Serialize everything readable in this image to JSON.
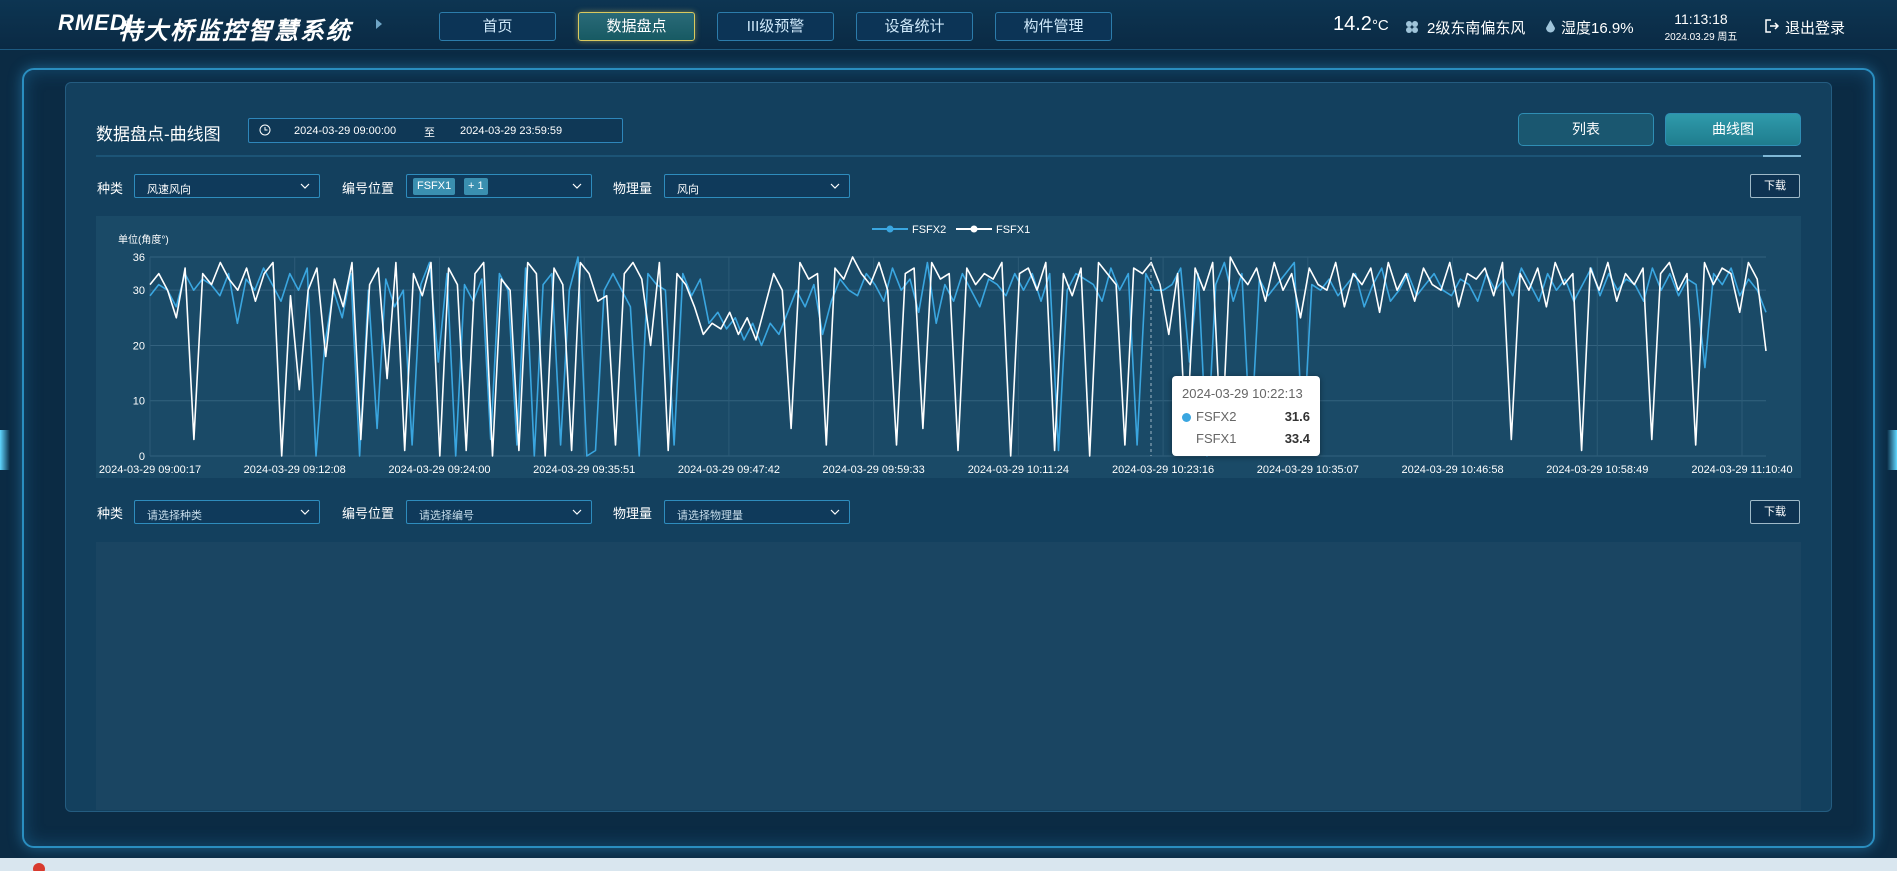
{
  "header": {
    "logo": "RMEDI",
    "title": "特大桥监控智慧系统",
    "nav": [
      {
        "label": "首页",
        "active": false
      },
      {
        "label": "数据盘点",
        "active": true
      },
      {
        "label": "III级预警",
        "active": false
      },
      {
        "label": "设备统计",
        "active": false
      },
      {
        "label": "构件管理",
        "active": false
      }
    ],
    "weather": {
      "temperature": "14.2",
      "temperature_unit": "°C",
      "wind": "2级东南偏东风",
      "humidity": "湿度16.9%"
    },
    "time": "11:13:18",
    "date": "2024.03.29 周五",
    "logout": "退出登录"
  },
  "page": {
    "title": "数据盘点-曲线图",
    "date_start": "2024-03-29 09:00:00",
    "date_separator": "至",
    "date_end": "2024-03-29 23:59:59",
    "view_list": "列表",
    "view_chart": "曲线图",
    "active_view": "曲线图"
  },
  "filter1": {
    "type_label": "种类",
    "type_value": "风速风向",
    "position_label": "编号位置",
    "position_tags": [
      "FSFX1",
      "+ 1"
    ],
    "quantity_label": "物理量",
    "quantity_value": "风向",
    "download": "下载"
  },
  "filter2": {
    "type_label": "种类",
    "type_placeholder": "请选择种类",
    "position_label": "编号位置",
    "position_placeholder": "请选择编号",
    "quantity_label": "物理量",
    "quantity_placeholder": "请选择物理量",
    "download": "下载"
  },
  "tooltip": {
    "title": "2024-03-29 10:22:13",
    "rows": [
      {
        "name": "FSFX2",
        "value": "31.6",
        "color": "#3aa6e0"
      },
      {
        "name": "FSFX1",
        "value": "33.4",
        "color": "#ffffff"
      }
    ]
  },
  "chart_data": {
    "type": "line",
    "ylabel": "单位(角度°)",
    "ylim": [
      0,
      36
    ],
    "yticks": [
      0,
      10,
      20,
      30,
      36
    ],
    "x_tick_labels": [
      "2024-03-29 09:00:17",
      "2024-03-29 09:12:08",
      "2024-03-29 09:24:00",
      "2024-03-29 09:35:51",
      "2024-03-29 09:47:42",
      "2024-03-29 09:59:33",
      "2024-03-29 10:11:24",
      "2024-03-29 10:23:16",
      "2024-03-29 10:35:07",
      "2024-03-29 10:46:58",
      "2024-03-29 10:58:49",
      "2024-03-29 11:10:40"
    ],
    "legend_position": "top-center",
    "grid": true,
    "series": [
      {
        "name": "FSFX2",
        "color": "#3aa6e0",
        "values": [
          29,
          31,
          30,
          27,
          33,
          30,
          32,
          31,
          29,
          33,
          24,
          32,
          30,
          34,
          31,
          28,
          33,
          30,
          34,
          0,
          20,
          30,
          25,
          33,
          0,
          30,
          5,
          32,
          27,
          30,
          2,
          31,
          35,
          17,
          33,
          0,
          31,
          28,
          32,
          3,
          33,
          30,
          2,
          34,
          0,
          31,
          33,
          2,
          30,
          36,
          0,
          1,
          30,
          33,
          30,
          27,
          0,
          33,
          31,
          30,
          2,
          33,
          29,
          32,
          24,
          26,
          23,
          25,
          21,
          24,
          20,
          24,
          22,
          26,
          30,
          27,
          31,
          22,
          28,
          32,
          30,
          29,
          33,
          31,
          28,
          34,
          30,
          32,
          26,
          35,
          24,
          31,
          28,
          33,
          30,
          27,
          32,
          31,
          29,
          33,
          30,
          33,
          28,
          33,
          1,
          30,
          33,
          32,
          31,
          28,
          34,
          30,
          33,
          2,
          33,
          30,
          30,
          31,
          34,
          17,
          33,
          0,
          31,
          35,
          28,
          33,
          2,
          32,
          29,
          31,
          33,
          35,
          2,
          31,
          30,
          32,
          29,
          31,
          33,
          27,
          31,
          34,
          28,
          30,
          33,
          29,
          31,
          33,
          30,
          29,
          32,
          31,
          28,
          33,
          30,
          32,
          29,
          34,
          31,
          28,
          33,
          30,
          32,
          28,
          31,
          34,
          29,
          33,
          30,
          32,
          31,
          28,
          34,
          30,
          33,
          29,
          32,
          31,
          16,
          33,
          31,
          34,
          29,
          32,
          30,
          26
        ]
      },
      {
        "name": "FSFX1",
        "color": "#ffffff",
        "values": [
          31,
          33,
          30,
          25,
          34,
          3,
          33,
          31,
          35,
          32,
          30,
          34,
          28,
          33,
          35,
          0,
          29,
          12,
          30,
          34,
          18,
          32,
          27,
          35,
          3,
          31,
          34,
          14,
          35,
          1,
          33,
          29,
          35,
          0,
          34,
          31,
          1,
          33,
          35,
          0,
          32,
          30,
          1,
          35,
          33,
          0,
          34,
          31,
          1,
          35,
          33,
          28,
          29,
          2,
          33,
          35,
          32,
          20,
          35,
          1,
          33,
          31,
          27,
          22,
          24,
          23,
          26,
          22,
          25,
          21,
          27,
          33,
          30,
          5,
          35,
          32,
          33,
          2,
          34,
          32,
          36,
          33,
          31,
          35,
          30,
          2,
          33,
          34,
          5,
          35,
          32,
          33,
          1,
          34,
          31,
          33,
          32,
          35,
          0,
          33,
          34,
          30,
          35,
          1,
          33,
          29,
          34,
          0,
          35,
          33,
          31,
          2,
          34,
          33,
          35,
          31,
          22,
          33,
          2,
          34,
          30,
          35,
          1,
          36,
          33,
          31,
          34,
          28,
          35,
          30,
          33,
          25,
          34,
          31,
          30,
          35,
          27,
          33,
          31,
          34,
          26,
          35,
          30,
          33,
          28,
          34,
          31,
          30,
          35,
          27,
          33,
          32,
          34,
          29,
          35,
          3,
          33,
          30,
          34,
          27,
          35,
          31,
          33,
          1,
          34,
          30,
          35,
          28,
          33,
          31,
          34,
          3,
          33,
          35,
          30,
          33,
          2,
          35,
          31,
          34,
          33,
          26,
          35,
          32,
          19
        ]
      }
    ]
  }
}
